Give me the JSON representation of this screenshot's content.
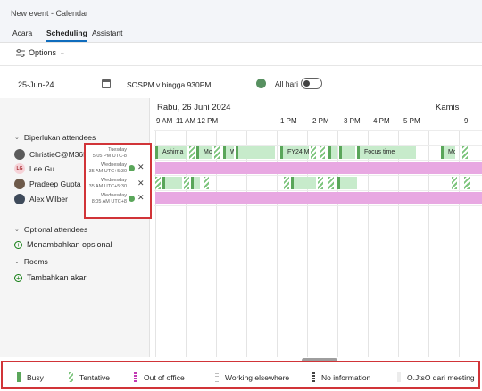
{
  "window": {
    "title": "New event - Calendar"
  },
  "tabs": [
    {
      "label": "Acara"
    },
    {
      "label": "Scheduling"
    },
    {
      "label": "Assistant"
    }
  ],
  "toolbar": {
    "options_label": "Options"
  },
  "event": {
    "date": "25-Jun-24",
    "time_range": "SOSPM v hingga 930PM",
    "all_day_label": "All hari"
  },
  "attendees": {
    "required_heading": "Diperlukan attendees",
    "people": [
      {
        "name": "ChristieC@M365x2...",
        "initials": "",
        "tz_day": "Tuesday",
        "tz_time": "5:05 PM UTC-8"
      },
      {
        "name": "Lee Gu",
        "initials": "LG",
        "tz_day": "Wednesday",
        "tz_time": "35 AM UTC+5:30"
      },
      {
        "name": "Pradeep Gupta",
        "initials": "",
        "tz_day": "Wednesday",
        "tz_time": "35 AM UTC+5:30"
      },
      {
        "name": "Alex Wilber",
        "initials": "",
        "tz_day": "Wednesday",
        "tz_time": "8:05 AM UTC+8"
      }
    ],
    "optional_heading": "Optional attendees",
    "add_optional": "Menambahkan opsional",
    "rooms_heading": "Rooms",
    "add_room": "Tambahkan akar'"
  },
  "timeline": {
    "day1": "Rabu, 26 Juni 2024",
    "day2": "Kamis",
    "hours": [
      "9 AM",
      "11 AM",
      "12 PM",
      "1 PM",
      "2 PM",
      "3 PM",
      "4 PM",
      "5 PM",
      "9"
    ],
    "events": [
      {
        "label": "Ashima"
      },
      {
        "label": "Mc"
      },
      {
        "label": "W"
      },
      {
        "label": "FY24 M"
      },
      {
        "label": "Focus time"
      },
      {
        "label": "Mc"
      }
    ]
  },
  "legend": [
    {
      "label": "Busy"
    },
    {
      "label": "Tentative"
    },
    {
      "label": "Out of office"
    },
    {
      "label": "Working elsewhere"
    },
    {
      "label": "No information"
    },
    {
      "label": "O.JtsO dari meeting"
    }
  ],
  "colors": {
    "busy": "#5aa65a",
    "out_of_office": "#e8a8e2",
    "accent": "#0f6cbd",
    "highlight_border": "#d13438"
  }
}
